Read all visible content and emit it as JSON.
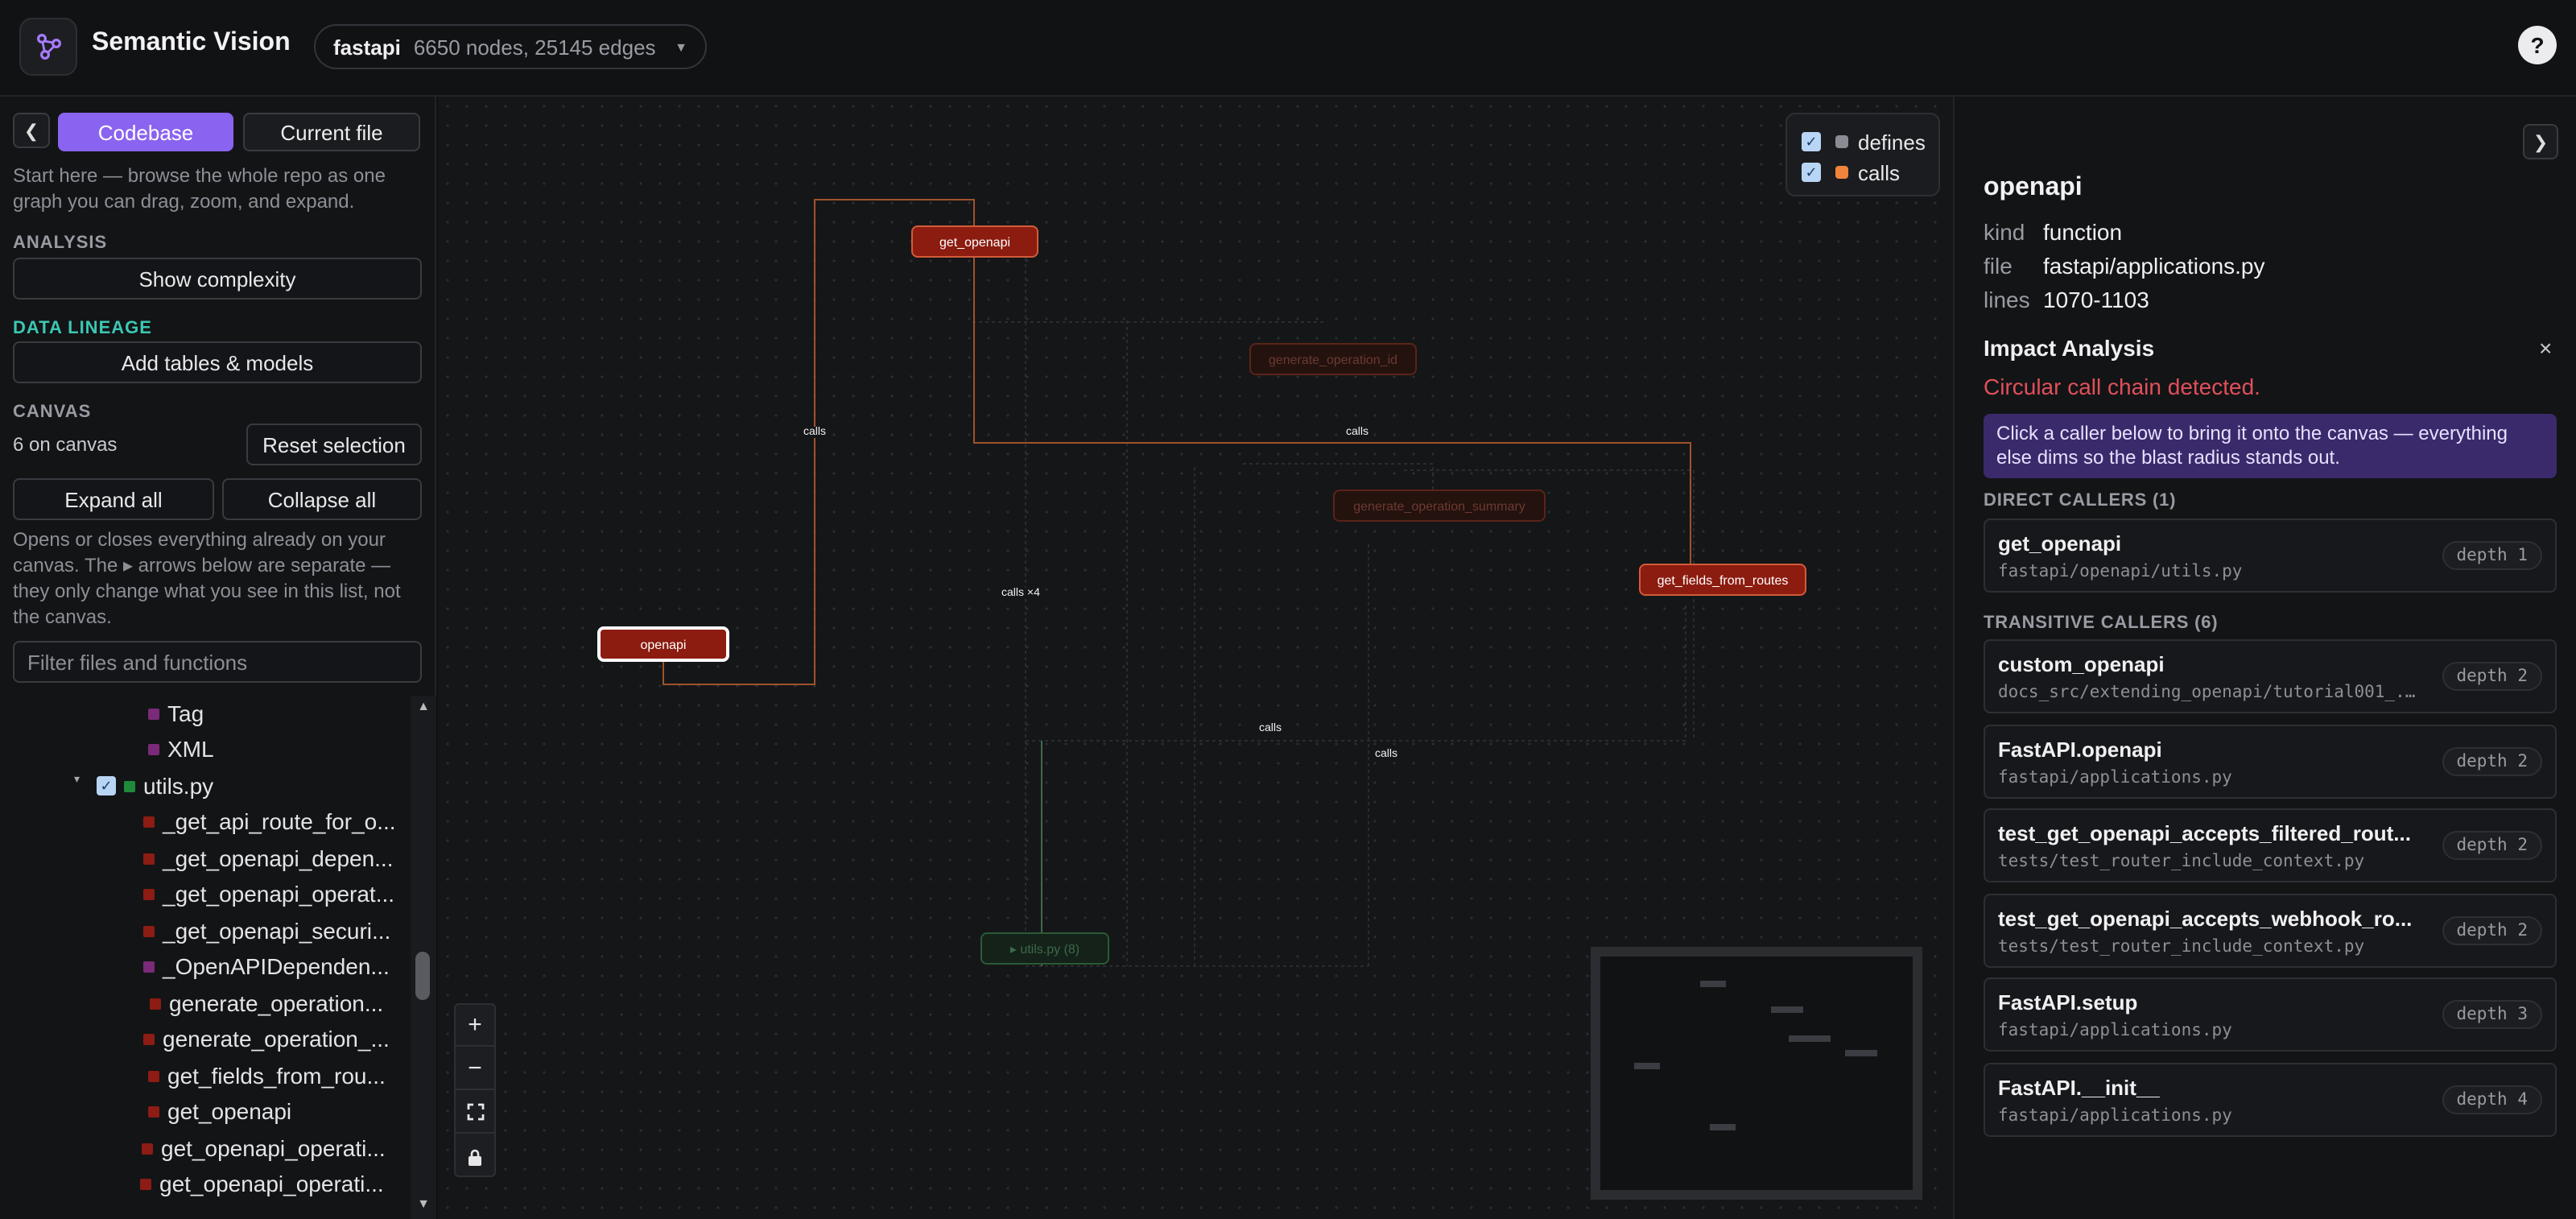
{
  "app": {
    "title": "Semantic Vision"
  },
  "repo": {
    "name": "fastapi",
    "stats": "6650 nodes, 25145 edges"
  },
  "help": "?",
  "sidebar": {
    "tabs": {
      "codebase": "Codebase",
      "current_file": "Current file"
    },
    "intro": "Start here — browse the whole repo as one graph you can drag, zoom, and expand.",
    "analysis_label": "ANALYSIS",
    "show_complexity": "Show complexity",
    "lineage_label": "DATA LINEAGE",
    "add_tables": "Add tables & models",
    "canvas_label": "CANVAS",
    "on_canvas": "6 on canvas",
    "reset_selection": "Reset selection",
    "expand_all": "Expand all",
    "collapse_all": "Collapse all",
    "expand_note": "Opens or closes everything already on your canvas. The ▸ arrows below are separate — they only change what you see in this list, not the canvas.",
    "filter_placeholder": "Filter files and functions",
    "tree": [
      {
        "label": "Tag",
        "kind": "class"
      },
      {
        "label": "XML",
        "kind": "class"
      },
      {
        "label": "utils.py",
        "kind": "file"
      },
      {
        "label": "_get_api_route_for_o...",
        "kind": "function"
      },
      {
        "label": "_get_openapi_depen...",
        "kind": "function"
      },
      {
        "label": "_get_openapi_operat...",
        "kind": "function"
      },
      {
        "label": "_get_openapi_securi...",
        "kind": "function"
      },
      {
        "label": "_OpenAPIDependen...",
        "kind": "class"
      },
      {
        "label": "generate_operation...",
        "kind": "function"
      },
      {
        "label": "generate_operation_...",
        "kind": "function"
      },
      {
        "label": "get_fields_from_rou...",
        "kind": "function"
      },
      {
        "label": "get_openapi",
        "kind": "function"
      },
      {
        "label": "get_openapi_operati...",
        "kind": "function"
      },
      {
        "label": "get_openapi_operati...",
        "kind": "function"
      }
    ]
  },
  "canvas": {
    "legend": [
      {
        "label": "defines",
        "color": "#8a8c94",
        "checked": true
      },
      {
        "label": "calls",
        "color": "#f0843c",
        "checked": true
      }
    ],
    "nodes": {
      "get_openapi": "get_openapi",
      "generate_operation_id": "generate_operation_id",
      "generate_operation_summary": "generate_operation_summary",
      "get_fields_from_routes": "get_fields_from_routes",
      "openapi": "openapi",
      "utils_group": "▸ utils.py (8)"
    },
    "edge_labels": {
      "calls_1": "calls",
      "calls_2": "calls",
      "calls_x4": "calls ×4",
      "calls_3": "calls",
      "calls_4": "calls"
    },
    "zoom": {
      "in": "+",
      "out": "−",
      "fit": "⛶",
      "lock": "🔒"
    }
  },
  "detail": {
    "name": "openapi",
    "kind_label": "kind",
    "kind": "function",
    "file_label": "file",
    "file": "fastapi/applications.py",
    "lines_label": "lines",
    "lines": "1070-1103",
    "impact_title": "Impact Analysis",
    "close": "×",
    "circular": "Circular call chain detected.",
    "hint": "Click a caller below to bring it onto the canvas — everything else dims so the blast radius stands out.",
    "direct_label": "DIRECT CALLERS (1)",
    "transitive_label": "TRANSITIVE CALLERS (6)",
    "direct": [
      {
        "name": "get_openapi",
        "path": "fastapi/openapi/utils.py",
        "depth": "depth 1"
      }
    ],
    "transitive": [
      {
        "name": "custom_openapi",
        "path": "docs_src/extending_openapi/tutorial001_...",
        "depth": "depth 2"
      },
      {
        "name": "FastAPI.openapi",
        "path": "fastapi/applications.py",
        "depth": "depth 2"
      },
      {
        "name": "test_get_openapi_accepts_filtered_rout...",
        "path": "tests/test_router_include_context.py",
        "depth": "depth 2"
      },
      {
        "name": "test_get_openapi_accepts_webhook_ro...",
        "path": "tests/test_router_include_context.py",
        "depth": "depth 2"
      },
      {
        "name": "FastAPI.setup",
        "path": "fastapi/applications.py",
        "depth": "depth 3"
      },
      {
        "name": "FastAPI.__init__",
        "path": "fastapi/applications.py",
        "depth": "depth 4"
      }
    ]
  }
}
